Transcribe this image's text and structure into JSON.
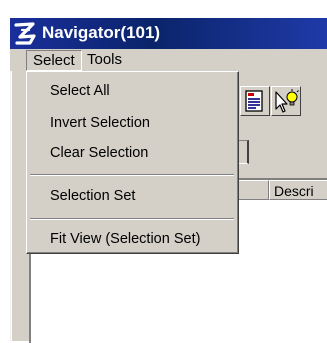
{
  "window": {
    "title": "Navigator(101)"
  },
  "menubar": {
    "items": [
      {
        "label": "Select"
      },
      {
        "label": "Tools"
      }
    ]
  },
  "select_menu": {
    "items": [
      {
        "label": "Select All"
      },
      {
        "label": "Invert Selection"
      },
      {
        "label": "Clear Selection"
      },
      {
        "label": "Selection Set"
      },
      {
        "label": "Fit View (Selection Set)"
      }
    ]
  },
  "toolbar": {
    "buttons": [
      {
        "icon": "document-list-icon"
      },
      {
        "icon": "pointer-lightbulb-icon"
      }
    ]
  },
  "list": {
    "columns": [
      {
        "label": ""
      },
      {
        "label": "Descri"
      }
    ]
  },
  "colors": {
    "titlebar": "#0a246a",
    "face": "#d4d0c8",
    "list_bg": "#ffffff"
  }
}
